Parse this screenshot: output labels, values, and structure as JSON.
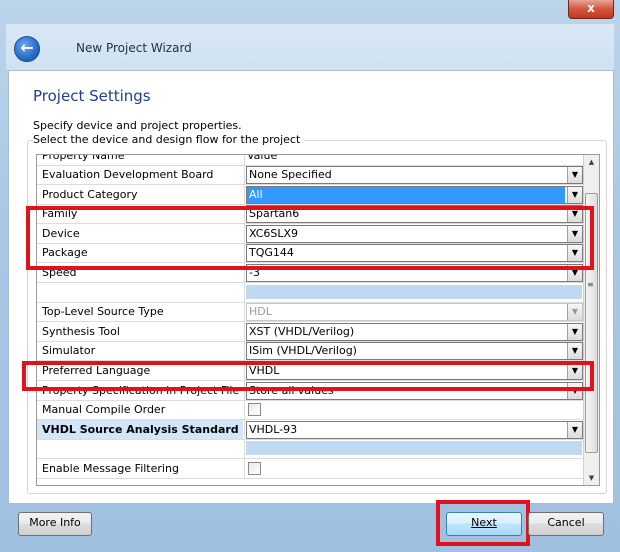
{
  "window": {
    "close_label": "x",
    "wizard_title": "New Project Wizard",
    "back_glyph": "←"
  },
  "page": {
    "title": "Project Settings",
    "description": "Specify device and project properties.",
    "group_label": "Select the device and design flow for the project"
  },
  "grid": {
    "header_name": "Property Name",
    "header_value": "Value",
    "rows": [
      {
        "name": "Evaluation Development Board",
        "value": "None Specified",
        "kind": "combo"
      },
      {
        "name": "Product Category",
        "value": "All",
        "kind": "combo-selected"
      },
      {
        "name": "Family",
        "value": "Spartan6",
        "kind": "combo"
      },
      {
        "name": "Device",
        "value": "XC6SLX9",
        "kind": "combo"
      },
      {
        "name": "Package",
        "value": "TQG144",
        "kind": "combo"
      },
      {
        "name": "Speed",
        "value": "-3",
        "kind": "combo"
      },
      {
        "name": "",
        "value": "",
        "kind": "blank"
      },
      {
        "name": "Top-Level Source Type",
        "value": "HDL",
        "kind": "combo-disabled"
      },
      {
        "name": "Synthesis Tool",
        "value": "XST (VHDL/Verilog)",
        "kind": "combo"
      },
      {
        "name": "Simulator",
        "value": "ISim (VHDL/Verilog)",
        "kind": "combo"
      },
      {
        "name": "Preferred Language",
        "value": "VHDL",
        "kind": "combo"
      },
      {
        "name": "Property Specification in Project File",
        "value": "Store all values",
        "kind": "combo"
      },
      {
        "name": "Manual Compile Order",
        "value": "",
        "kind": "checkbox"
      },
      {
        "name": "VHDL Source Analysis Standard",
        "value": "VHDL-93",
        "kind": "combo-bold"
      },
      {
        "name": "",
        "value": "",
        "kind": "blank"
      },
      {
        "name": "Enable Message Filtering",
        "value": "",
        "kind": "checkbox"
      }
    ]
  },
  "buttons": {
    "more_info": "More Info",
    "next": "Next",
    "cancel": "Cancel"
  },
  "colors": {
    "highlight": "#e0121b",
    "selection": "#3399ff",
    "title": "#1f3f8f"
  }
}
